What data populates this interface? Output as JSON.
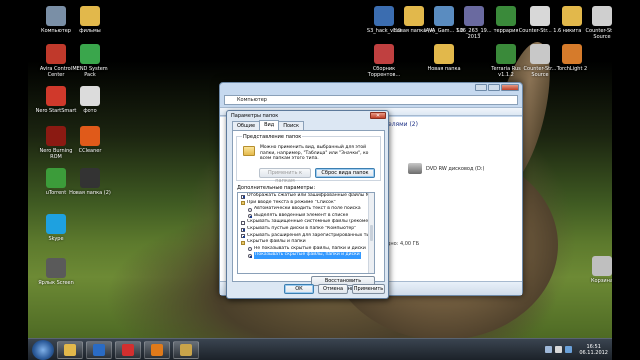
{
  "desktop": {
    "icons": [
      {
        "label": "Компьютер",
        "color": "#7a8fa6"
      },
      {
        "label": "фильмы",
        "color": "#e2b84b"
      },
      {
        "label": "Avira Control Center",
        "color": "#c0392b"
      },
      {
        "label": "MEND System Pack",
        "color": "#3aa64c"
      },
      {
        "label": "Nero StartSmart",
        "color": "#d0392b"
      },
      {
        "label": "фото",
        "color": "#dcdcdc"
      },
      {
        "label": "Nero Burning ROM",
        "color": "#8b1a12"
      },
      {
        "label": "CCleaner",
        "color": "#e05a1a"
      },
      {
        "label": "uTorrent",
        "color": "#3c9c3a"
      },
      {
        "label": "Новая папка (2)",
        "color": "#333333"
      },
      {
        "label": "Skype",
        "color": "#1ea1e0"
      },
      {
        "label": "Ярлык Screen",
        "color": "#5a5a5a"
      },
      {
        "label": "S3_hack_v1.0",
        "color": "#3b6db0"
      },
      {
        "label": "Новая папка (4)",
        "color": "#e2b84b"
      },
      {
        "label": "IAVA_Gam... 1.8",
        "color": "#5a8cc0"
      },
      {
        "label": "S06_263_19... 2013",
        "color": "#6a6aa0"
      },
      {
        "label": "террария",
        "color": "#3a8a3a"
      },
      {
        "label": "Counter-Str... 1.6",
        "color": "#d8d8d8"
      },
      {
        "label": "никита",
        "color": "#e2b84b"
      },
      {
        "label": "Counter-Str... Source",
        "color": "#cfcfcf"
      },
      {
        "label": "Сборник Торрентов...",
        "color": "#c04040"
      },
      {
        "label": "Новая папка",
        "color": "#e2b84b"
      },
      {
        "label": "Terraria Rus v1.1.2",
        "color": "#3a8a3a"
      },
      {
        "label": "Counter-Str... Source",
        "color": "#c8c8c8"
      },
      {
        "label": "TorchLight 2",
        "color": "#d67b2b"
      },
      {
        "label": "Корзина",
        "color": "#bfbfbf"
      }
    ]
  },
  "taskbar": {
    "buttons": [
      {
        "name": "explorer",
        "color": "#e2b84b"
      },
      {
        "name": "media-player",
        "color": "#2a6bc4"
      },
      {
        "name": "yandex",
        "color": "#d32f2f"
      },
      {
        "name": "half-life",
        "color": "#e07a1a"
      },
      {
        "name": "folder-options",
        "color": "#c9a44a"
      }
    ],
    "time": "16:51",
    "date": "06.11.2012"
  },
  "explorer": {
    "address": "Компьютер",
    "group_header": "елями (2)",
    "drive_label": "DVD RW дисковод (D:)",
    "free_space": "свободно: 4,00 ГБ"
  },
  "dialog": {
    "title": "Параметры папок",
    "close_glyph": "✕",
    "tabs": [
      "Общие",
      "Вид",
      "Поиск"
    ],
    "active_tab": "Вид",
    "folder_views": {
      "legend": "Представление папок",
      "description": "Можно применить вид, выбранный для этой папки, например, \"Таблица\" или \"Значки\", ко всем папкам этого типа.",
      "apply_button": "Применить к папкам",
      "reset_button": "Сброс вида папок"
    },
    "advanced_label": "Дополнительные параметры:",
    "advanced_items": [
      {
        "text": "Отображать сжатые или зашифрованные файлы NTF",
        "kind": "check",
        "checked": true,
        "indent": 1
      },
      {
        "text": "При вводе текста в режиме \"Список\"",
        "kind": "folder",
        "checked": false,
        "indent": 1
      },
      {
        "text": "Автоматически вводить текст в поле поиска",
        "kind": "radio",
        "checked": false,
        "indent": 2
      },
      {
        "text": "Выделять введенный элемент в списке",
        "kind": "radio",
        "checked": true,
        "indent": 2
      },
      {
        "text": "Скрывать защищенные системные файлы (рекоменд",
        "kind": "check",
        "checked": false,
        "indent": 1
      },
      {
        "text": "Скрывать пустые диски в папке \"Компьютер\"",
        "kind": "check",
        "checked": true,
        "indent": 1
      },
      {
        "text": "Скрывать расширения для зарегистрированных типов",
        "kind": "check",
        "checked": true,
        "indent": 1
      },
      {
        "text": "Скрытые файлы и папки",
        "kind": "folder",
        "checked": false,
        "indent": 1
      },
      {
        "text": "Не показывать скрытые файлы, папки и диски",
        "kind": "radio",
        "checked": false,
        "indent": 2
      },
      {
        "text": "Показывать скрытые файлы, папки и диски",
        "kind": "radio",
        "checked": true,
        "indent": 2,
        "selected": true
      }
    ],
    "restore_button": "Восстановить умолчания",
    "ok_button": "ОК",
    "cancel_button": "Отмена",
    "apply_button": "Применить"
  }
}
